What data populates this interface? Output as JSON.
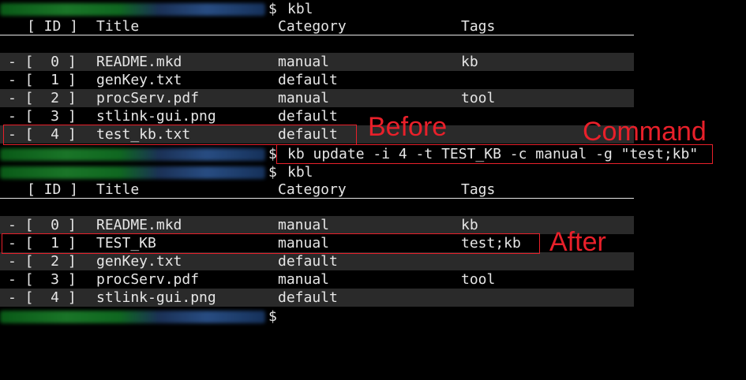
{
  "terminal": {
    "prompt_symbol": "$",
    "commands": {
      "first": "kbl",
      "update": "kb update -i 4 -t TEST_KB -c manual -g \"test;kb\"",
      "second": "kbl",
      "last": ""
    }
  },
  "table_header": {
    "id": "[ ID ]",
    "title": "Title",
    "category": "Category",
    "tags": "Tags"
  },
  "table_before": [
    {
      "id": "- [  0 ]",
      "title": "README.mkd",
      "category": "manual",
      "tags": "kb"
    },
    {
      "id": "- [  1 ]",
      "title": "genKey.txt",
      "category": "default",
      "tags": ""
    },
    {
      "id": "- [  2 ]",
      "title": "procServ.pdf",
      "category": "manual",
      "tags": "tool"
    },
    {
      "id": "- [  3 ]",
      "title": "stlink-gui.png",
      "category": "default",
      "tags": ""
    },
    {
      "id": "- [  4 ]",
      "title": "test_kb.txt",
      "category": "default",
      "tags": ""
    }
  ],
  "table_after": [
    {
      "id": "- [  0 ]",
      "title": "README.mkd",
      "category": "manual",
      "tags": "kb"
    },
    {
      "id": "- [  1 ]",
      "title": "TEST_KB",
      "category": "manual",
      "tags": "test;kb"
    },
    {
      "id": "- [  2 ]",
      "title": "genKey.txt",
      "category": "default",
      "tags": ""
    },
    {
      "id": "- [  3 ]",
      "title": "procServ.pdf",
      "category": "manual",
      "tags": "tool"
    },
    {
      "id": "- [  4 ]",
      "title": "stlink-gui.png",
      "category": "default",
      "tags": ""
    }
  ],
  "annotations": {
    "before": "Before",
    "command": "Command",
    "after": "After"
  },
  "colors": {
    "background": "#000000",
    "text": "#e6e6e6",
    "stripe": "#2a2a2a",
    "annotation": "#e8202a"
  }
}
